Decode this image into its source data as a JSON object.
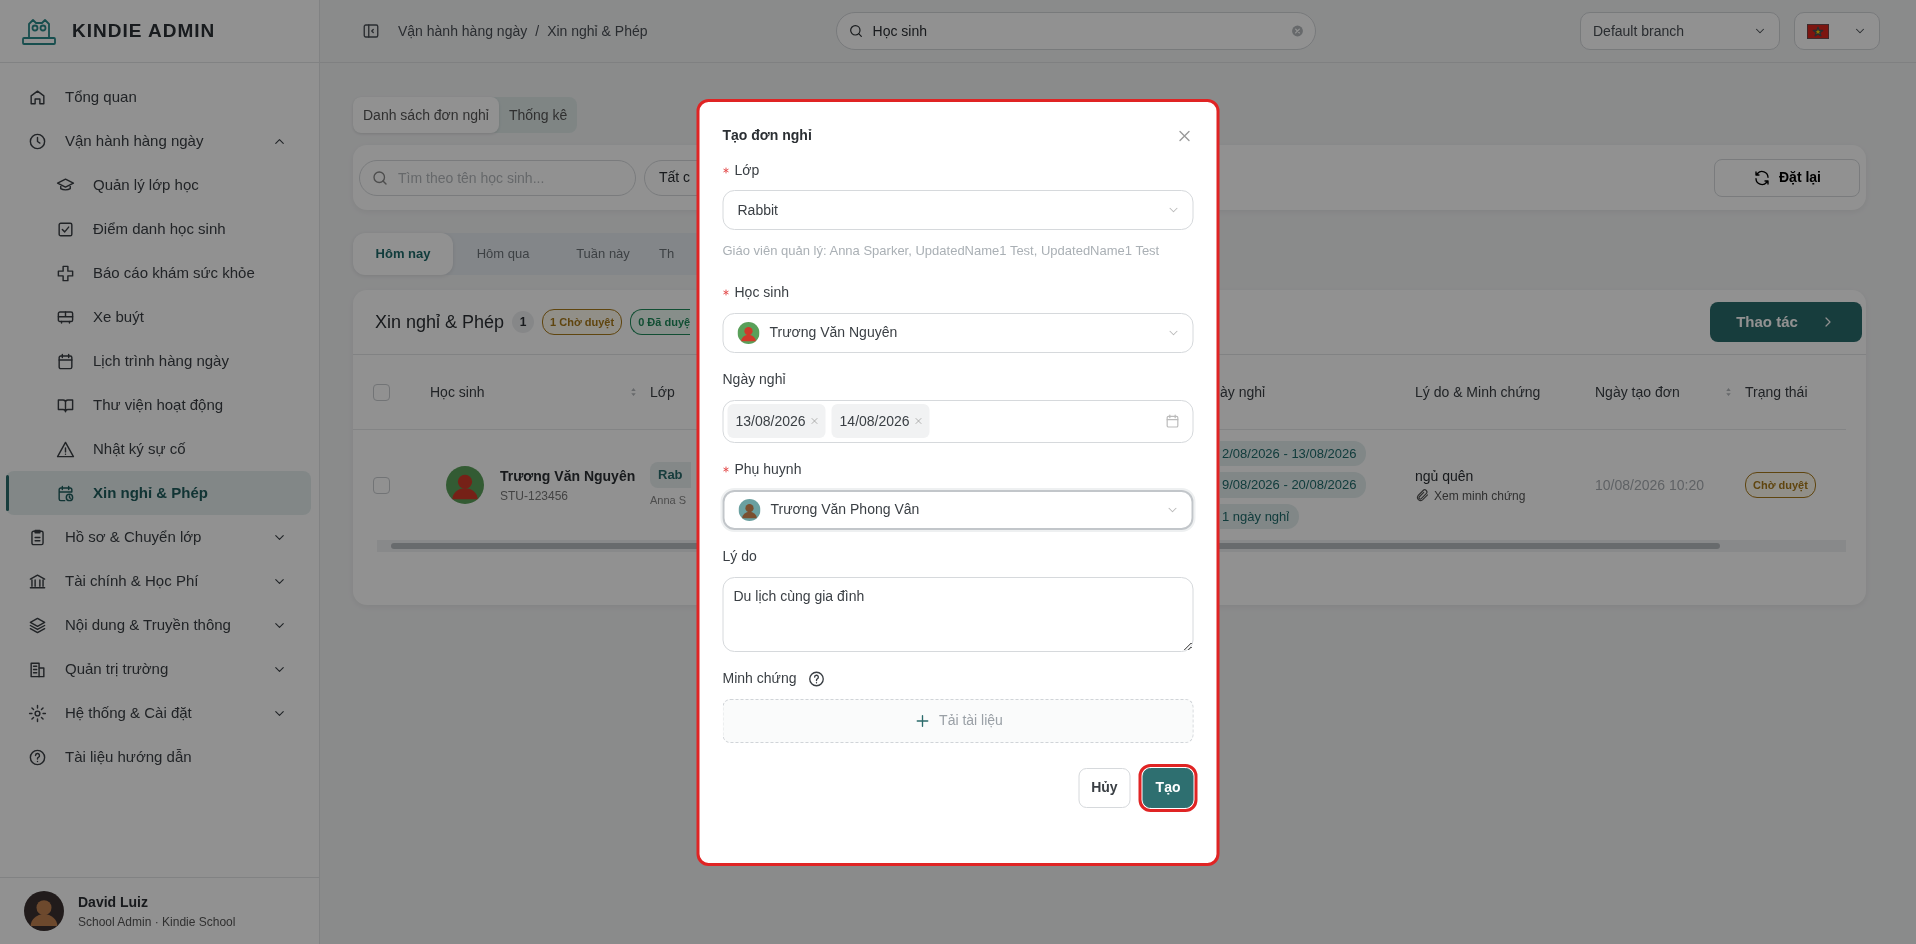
{
  "sidebar": {
    "logo": "KINDIE ADMIN",
    "items": [
      {
        "label": "Tổng quan",
        "selected": false
      },
      {
        "label": "Vận hành hàng ngày",
        "selected": false,
        "expanded": true,
        "children": [
          {
            "label": "Quản lý lớp học",
            "selected": false
          },
          {
            "label": "Điểm danh học sinh",
            "selected": false
          },
          {
            "label": "Báo cáo khám sức khỏe",
            "selected": false
          },
          {
            "label": "Xe buýt",
            "selected": false
          },
          {
            "label": "Lịch trình hàng ngày",
            "selected": false
          },
          {
            "label": "Thư viện hoạt động",
            "selected": false
          },
          {
            "label": "Nhật ký sự cố",
            "selected": false
          },
          {
            "label": "Xin nghỉ & Phép",
            "selected": true
          }
        ]
      },
      {
        "label": "Hồ sơ & Chuyển lớp",
        "selected": false,
        "expanded": false
      },
      {
        "label": "Tài chính & Học Phí",
        "selected": false,
        "expanded": false
      },
      {
        "label": "Nội dung & Truyền thông",
        "selected": false,
        "expanded": false
      },
      {
        "label": "Quản trị trường",
        "selected": false,
        "expanded": false
      },
      {
        "label": "Hệ thống & Cài đặt",
        "selected": false,
        "expanded": false
      },
      {
        "label": "Tài liệu hướng dẫn",
        "selected": false
      }
    ],
    "user": {
      "name": "David Luiz",
      "role": "School Admin · Kindie School"
    }
  },
  "header": {
    "breadcrumb": [
      "Vận hành hàng ngày",
      "Xin nghỉ & Phép"
    ],
    "breadcrumb_separator": "/",
    "search": {
      "value": "Học sinh"
    },
    "branch": "Default branch"
  },
  "view_tabs": [
    {
      "label": "Danh sách đơn nghỉ",
      "selected": true
    },
    {
      "label": "Thống kê",
      "selected": false
    }
  ],
  "filters": {
    "search": {
      "placeholder": "Tìm theo tên học sinh..."
    },
    "status_filter": "Tất c",
    "reset": "Đặt lại"
  },
  "period_tabs": [
    {
      "label": "Hôm nay",
      "selected": true
    },
    {
      "label": "Hôm qua",
      "selected": false
    },
    {
      "label": "Tuần này",
      "selected": false
    },
    {
      "label": "Th",
      "selected": false
    }
  ],
  "list": {
    "title": "Xin nghỉ & Phép",
    "count": "1",
    "badges": [
      {
        "label": "1 Chờ duyệt",
        "kind": "pending"
      },
      {
        "label": "0 Đã duyệ",
        "kind": "approved"
      }
    ],
    "action": "Thao tác",
    "table": {
      "all_selected": false,
      "columns": [
        {
          "label": "Học sinh",
          "sortable": true
        },
        {
          "label": "Lớp",
          "sortable": false
        },
        {
          "label": "ày nghỉ",
          "sortable": false
        },
        {
          "label": "Lý do & Minh chứng",
          "sortable": false
        },
        {
          "label": "Ngày tạo đơn",
          "sortable": true
        },
        {
          "label": "Trạng thái",
          "sortable": false
        }
      ],
      "rows": [
        {
          "selected": false,
          "student": {
            "name": "Trương Văn Nguyên",
            "code": "STU-123456"
          },
          "class": {
            "tag": "Rab",
            "teacher": "Anna S"
          },
          "dates": [
            "2/08/2026 - 13/08/2026",
            "9/08/2026 - 20/08/2026",
            "1 ngày nghỉ"
          ],
          "reason": {
            "text": "ngủ quên",
            "link": "Xem minh chứng"
          },
          "created": "10/08/2026 10:20",
          "status": {
            "label": "Chờ duyệt",
            "kind": "pending"
          }
        }
      ]
    }
  },
  "modal": {
    "title": "Tạo đơn nghỉ",
    "highlighted": true,
    "fields": [
      {
        "kind": "select",
        "label": "Lớp",
        "required": true,
        "value": "Rabbit",
        "focused": false
      },
      {
        "kind": "hint",
        "text": "Giáo viên quản lý: Anna Sparker, UpdatedName1 Test, UpdatedName1 Test"
      },
      {
        "kind": "select",
        "label": "Học sinh",
        "required": true,
        "value": "Trương Văn Nguyên",
        "avatar": true,
        "focused": false
      },
      {
        "kind": "dates",
        "label": "Ngày nghỉ",
        "required": false,
        "tags": [
          "13/08/2026",
          "14/08/2026"
        ]
      },
      {
        "kind": "select",
        "label": "Phụ huynh",
        "required": true,
        "value": "Trương Văn Phong Vân",
        "avatar": true,
        "focused": true
      },
      {
        "kind": "textarea",
        "label": "Lý do",
        "required": false,
        "value": "Du lịch cùng gia đình"
      },
      {
        "kind": "upload",
        "label": "Minh chứng",
        "required": false,
        "help": true,
        "button": "Tải tài liệu"
      }
    ],
    "buttons": [
      {
        "label": "Hủy",
        "kind": "secondary",
        "highlighted": false
      },
      {
        "label": "Tạo",
        "kind": "primary",
        "highlighted": true
      }
    ]
  }
}
